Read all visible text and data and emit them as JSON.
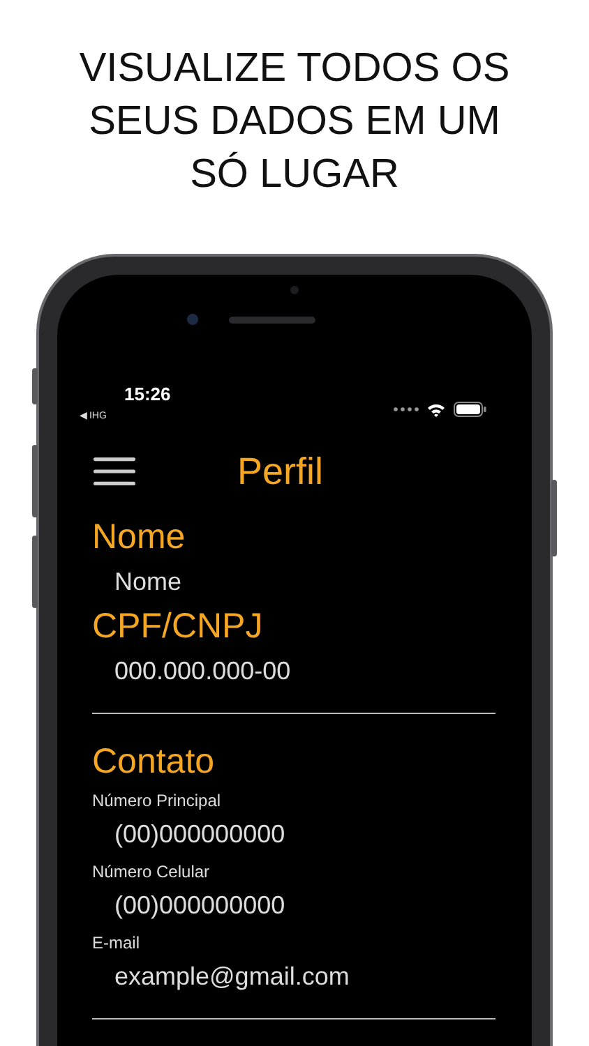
{
  "headline": "VISUALIZE TODOS OS SEUS DADOS EM UM SÓ LUGAR",
  "status_bar": {
    "time": "15:26",
    "back_label": "◀ IHG"
  },
  "header": {
    "title": "Perfil"
  },
  "sections": [
    {
      "title": "Nome",
      "divider": false,
      "fields": [
        {
          "value": "Nome"
        }
      ]
    },
    {
      "title": "CPF/CNPJ",
      "divider": true,
      "fields": [
        {
          "value": "000.000.000-00"
        }
      ]
    },
    {
      "title": "Contato",
      "divider": true,
      "fields": [
        {
          "label": "Número Principal",
          "value": "(00)000000000"
        },
        {
          "label": "Número Celular",
          "value": "(00)000000000"
        },
        {
          "label": "E-mail",
          "value": "example@gmail.com"
        }
      ]
    }
  ]
}
